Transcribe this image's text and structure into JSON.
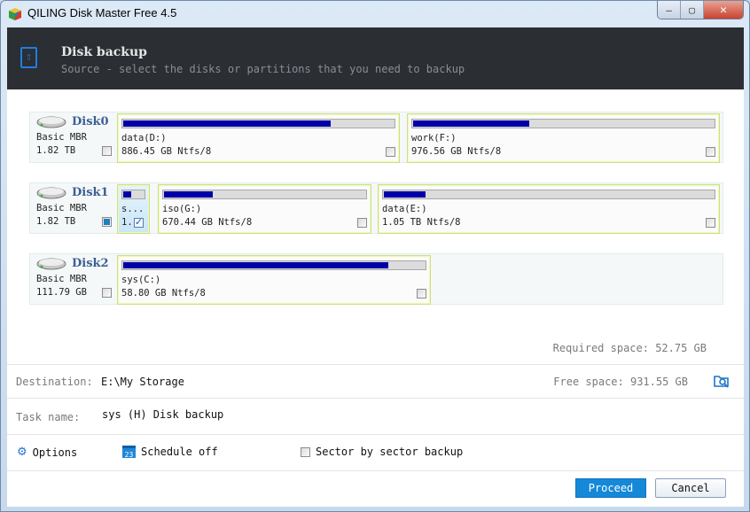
{
  "window": {
    "title": "QILING Disk Master Free 4.5",
    "buttons": {
      "minimize": "—",
      "maximize": "▢",
      "close": "✕"
    }
  },
  "header": {
    "title": "Disk backup",
    "subtitle": "Source - select the disks or partitions that you need to backup"
  },
  "disks": [
    {
      "name": "Disk0",
      "type": "Basic MBR",
      "size": "1.82 TB",
      "checkbox": "unchecked",
      "partitions": [
        {
          "label": "data(D:)",
          "size": "886.45 GB Ntfs/8",
          "used_fraction": 0.77,
          "checked": false,
          "selected": false
        },
        {
          "label": "work(F:)",
          "size": "976.56 GB Ntfs/8",
          "used_fraction": 0.39,
          "checked": false,
          "selected": false
        }
      ]
    },
    {
      "name": "Disk1",
      "type": "Basic MBR",
      "size": "1.82 TB",
      "checkbox": "partial",
      "partitions": [
        {
          "label": "s...",
          "size": "1.",
          "used_fraction": 0.45,
          "checked": true,
          "selected": true
        },
        {
          "label": "iso(G:)",
          "size": "670.44 GB Ntfs/8",
          "used_fraction": 0.25,
          "checked": false,
          "selected": false
        },
        {
          "label": "data(E:)",
          "size": "1.05 TB Ntfs/8",
          "used_fraction": 0.13,
          "checked": false,
          "selected": false
        }
      ]
    },
    {
      "name": "Disk2",
      "type": "Basic MBR",
      "size": "111.79 GB",
      "checkbox": "unchecked",
      "partitions": [
        {
          "label": "sys(C:)",
          "size": "58.80 GB Ntfs/8",
          "used_fraction": 0.88,
          "checked": false,
          "selected": false
        }
      ]
    }
  ],
  "required_space": "Required space: 52.75 GB",
  "destination": {
    "label": "Destination:",
    "value": "E:\\My Storage",
    "free_space": "Free space: 931.55 GB"
  },
  "task": {
    "label": "Task name:",
    "value": "sys (H) Disk backup"
  },
  "options": {
    "options_label": "Options",
    "schedule_label": "Schedule off",
    "schedule_day": "23",
    "sector_label": "Sector by sector backup",
    "sector_checked": false
  },
  "buttons": {
    "proceed": "Proceed",
    "cancel": "Cancel"
  },
  "colors": {
    "header_bg": "#2b2e33",
    "accent": "#1589d8",
    "bar_fill": "#0000a8",
    "disk_name": "#3c5f94"
  }
}
